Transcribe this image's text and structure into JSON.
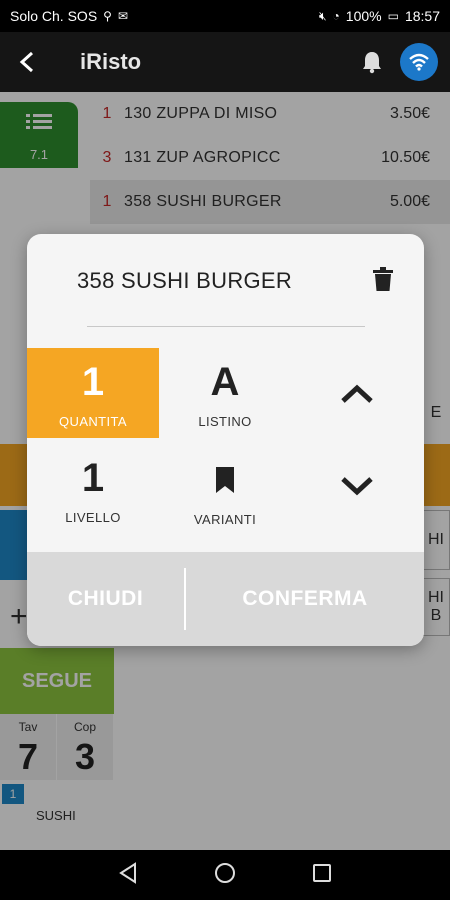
{
  "status_bar": {
    "carrier": "Solo Ch. SOS",
    "battery": "100%",
    "time": "18:57"
  },
  "app_bar": {
    "title": "iRisto"
  },
  "menu_tile": {
    "label": "7.1"
  },
  "order_rows": [
    {
      "qty": "1",
      "name": "130 ZUPPA DI MISO",
      "price": "3.50€"
    },
    {
      "qty": "3",
      "name": "131 ZUP AGROPICC",
      "price": "10.50€"
    },
    {
      "qty": "1",
      "name": "358 SUSHI BURGER",
      "price": "5.00€"
    }
  ],
  "background_cells": {
    "cell_e": "E",
    "cell_hi_1": "HI",
    "cell_hi_2": "HI",
    "cell_b": "B"
  },
  "bottom_panel": {
    "segue": "SEGUE",
    "tav_label": "Tav",
    "tav_value": "7",
    "cop_label": "Cop",
    "cop_value": "3",
    "badge": "1",
    "sushi_label": "SUSHI"
  },
  "dialog": {
    "title": "358 SUSHI BURGER",
    "quantita_value": "1",
    "quantita_label": "QUANTITA",
    "listino_value": "A",
    "listino_label": "LISTINO",
    "livello_value": "1",
    "livello_label": "LIVELLO",
    "varianti_label": "VARIANTI",
    "chiudi_label": "CHIUDI",
    "conferma_label": "CONFERMA"
  },
  "colors": {
    "accent_orange": "#f5a623",
    "menu_green": "#2e8f2e",
    "segue_green": "#8dc63f",
    "wifi_blue": "#1c78c9"
  },
  "icons": [
    "back-arrow-icon",
    "bell-icon",
    "wifi-icon",
    "list-icon",
    "trash-icon",
    "bookmark-icon",
    "chevron-up-icon",
    "chevron-down-icon",
    "nav-back-icon",
    "nav-home-icon",
    "nav-recents-icon"
  ]
}
